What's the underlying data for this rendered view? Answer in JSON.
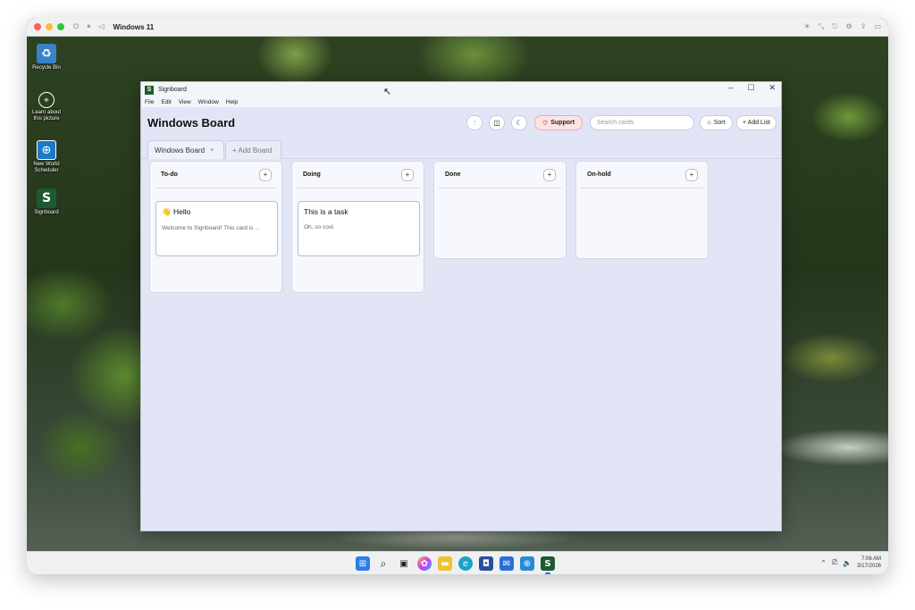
{
  "host": {
    "title": "Windows 11"
  },
  "desktop_icons": [
    {
      "label": "Recycle Bin",
      "icon": "recycle-bin-icon"
    },
    {
      "label": "Learn about this picture",
      "icon": "learn-picture-icon"
    },
    {
      "label": "New World Scheduler",
      "icon": "scheduler-app-icon"
    },
    {
      "label": "Signboard",
      "icon": "signboard-app-icon"
    }
  ],
  "app": {
    "title": "Signboard",
    "logo_letter": "S",
    "menu": [
      "File",
      "Edit",
      "View",
      "Window",
      "Help"
    ],
    "board_title": "Windows Board",
    "buttons": {
      "filter_icon": "sliders-icon",
      "columns_icon": "columns-icon",
      "theme_icon": "moon-icon",
      "support_label": "Support",
      "sort_label": "Sort",
      "add_list_label": "+ Add List"
    },
    "search_placeholder": "Search cards",
    "tabs": [
      {
        "label": "Windows Board",
        "close": "×"
      },
      {
        "label": "+ Add Board"
      }
    ],
    "lists": [
      {
        "title": "To-do",
        "add": "+",
        "cards": [
          {
            "title": "Hello",
            "emoji": "👋",
            "desc": "Welcome to Signboard! This card is ..."
          }
        ]
      },
      {
        "title": "Doing",
        "add": "+",
        "cards": [
          {
            "title": "This is a task",
            "desc": "Oh, so cool."
          }
        ]
      },
      {
        "title": "Done",
        "add": "+",
        "cards": []
      },
      {
        "title": "On-hold",
        "add": "+",
        "cards": []
      }
    ]
  },
  "taskbar": {
    "time": "7:06 AM",
    "date": "3/17/2026"
  },
  "colors": {
    "accent": "#1e5a2f",
    "support_bg": "#fde4e4",
    "app_bg": "#e1e5f6"
  }
}
